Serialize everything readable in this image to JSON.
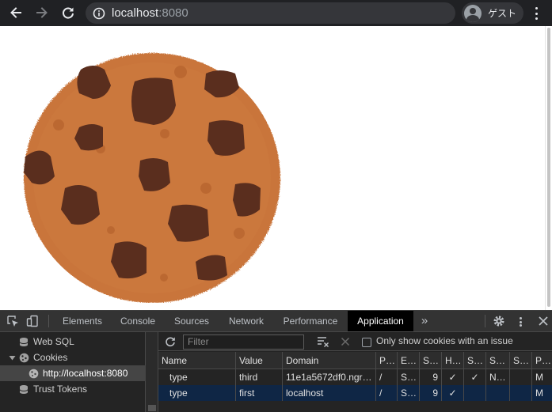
{
  "browser": {
    "url_host": "localhost",
    "url_port": ":8080",
    "profile_name": "ゲスト"
  },
  "devtools": {
    "tabs": [
      {
        "label": "Elements"
      },
      {
        "label": "Console"
      },
      {
        "label": "Sources"
      },
      {
        "label": "Network"
      },
      {
        "label": "Performance"
      },
      {
        "label": "Application",
        "active": true
      }
    ],
    "more_tabs": "»",
    "sidebar": {
      "items": [
        {
          "label": "Web SQL"
        },
        {
          "label": "Cookies",
          "expanded": true
        },
        {
          "label": "http://localhost:8080",
          "selected": true
        },
        {
          "label": "Trust Tokens"
        }
      ]
    },
    "filter": {
      "placeholder": "Filter",
      "only_issue_label": "Only show cookies with an issue",
      "only_issue_checked": false
    },
    "columns": [
      "Name",
      "Value",
      "Domain",
      "P…",
      "E…",
      "S…",
      "H…",
      "S…",
      "S…",
      "S…",
      "P…"
    ],
    "rows": [
      {
        "cells": [
          "type",
          "third",
          "11e1a5672df0.ngr…",
          "/",
          "S…",
          "9",
          "✓",
          "✓",
          "N…",
          "",
          "M"
        ],
        "selected": false
      },
      {
        "cells": [
          "type",
          "first",
          "localhost",
          "/",
          "S…",
          "9",
          "✓",
          "",
          "",
          "",
          "M"
        ],
        "selected": true
      }
    ]
  },
  "colors": {
    "toolbar_bg": "#202124",
    "devtools_bg": "#242424",
    "selected_row": "#0f2645",
    "cookie_base": "#c9743a",
    "chocolate": "#5a2e1e"
  }
}
